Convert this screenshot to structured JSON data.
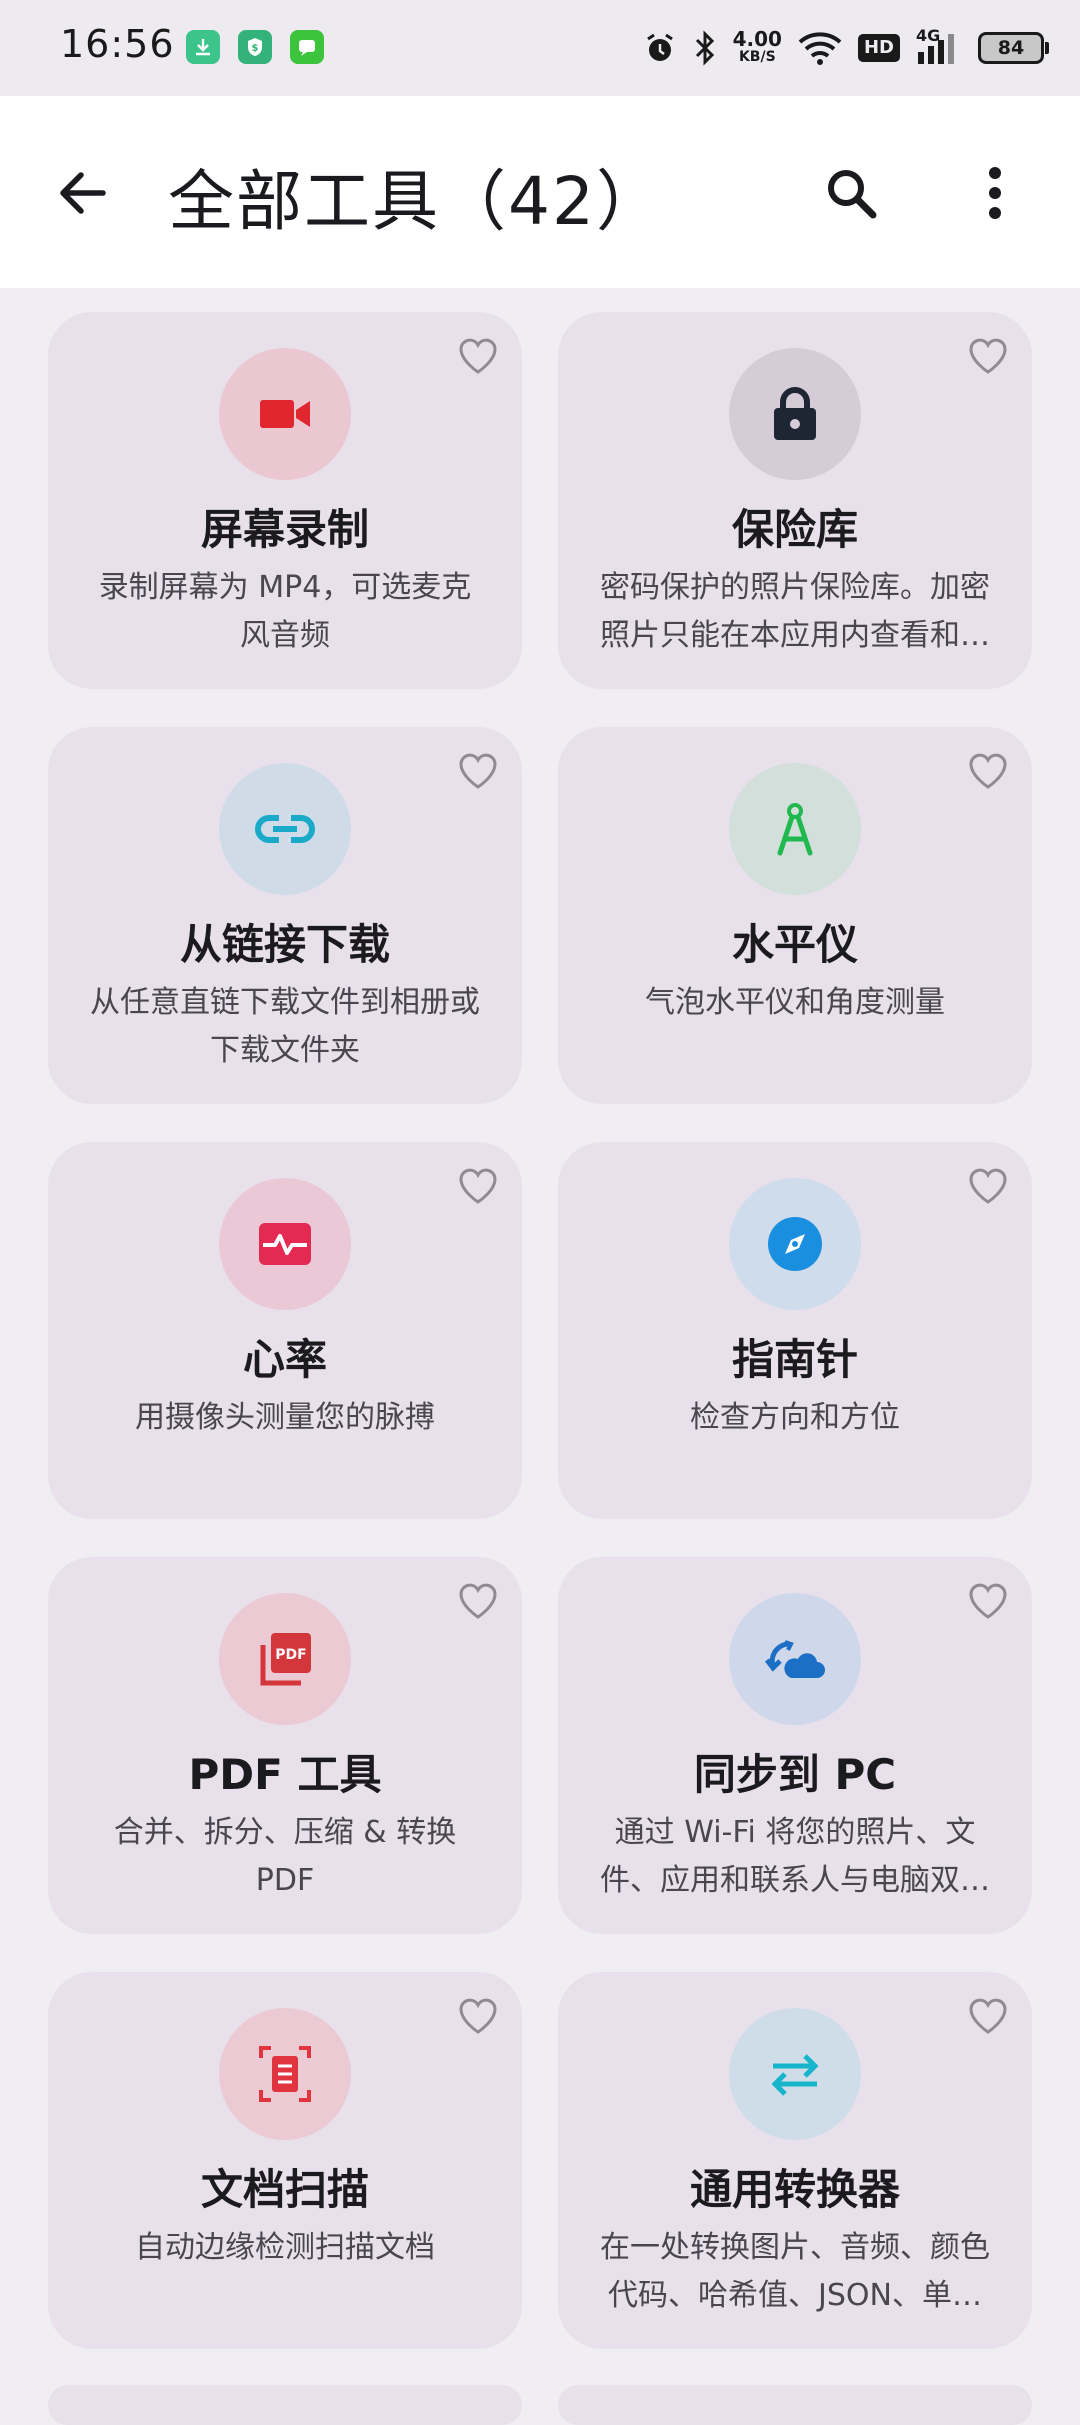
{
  "status_bar": {
    "time": "16:56",
    "net_speed_value": "4.00",
    "net_speed_unit": "KB/S",
    "hd": "HD",
    "cell": "4G",
    "battery": "84",
    "icons": [
      "download-app-icon",
      "shield-app-icon",
      "message-app-icon",
      "alarm-icon",
      "bluetooth-icon",
      "wifi-icon",
      "signal-icon",
      "battery-icon"
    ]
  },
  "app_bar": {
    "title": "全部工具（42）",
    "icons": [
      "back-arrow-icon",
      "search-icon",
      "more-vert-icon"
    ]
  },
  "tools": [
    {
      "title": "屏幕录制",
      "desc": "录制屏幕为 MP4，可选麦克风音频",
      "icon": "video-camera-icon",
      "icon_color": "#e0262e",
      "circle_color": "#ebc8d1"
    },
    {
      "title": "保险库",
      "desc": "密码保护的照片保险库。加密照片只能在本应用内查看和管理",
      "icon": "lock-icon",
      "icon_color": "#1f2633",
      "circle_color": "#d5ccd8"
    },
    {
      "title": "从链接下载",
      "desc": "从任意直链下载文件到相册或下载文件夹",
      "icon": "link-icon",
      "icon_color": "#19a9c9",
      "circle_color": "#cfdce8"
    },
    {
      "title": "水平仪",
      "desc": "气泡水平仪和角度测量",
      "icon": "compass-tool-icon",
      "icon_color": "#20b94f",
      "circle_color": "#d2dfdb"
    },
    {
      "title": "心率",
      "desc": "用摄像头测量您的脉搏",
      "icon": "heart-rate-icon",
      "icon_color": "#e42a52",
      "circle_color": "#eac8d6"
    },
    {
      "title": "指南针",
      "desc": "检查方向和方位",
      "icon": "compass-icon",
      "icon_color": "#1a8fe0",
      "circle_color": "#cfdcec"
    },
    {
      "title": "PDF 工具",
      "desc": "合并、拆分、压缩 & 转换 PDF",
      "icon": "pdf-icon",
      "icon_color": "#d3363b",
      "circle_color": "#ebcad3"
    },
    {
      "title": "同步到 PC",
      "desc": "通过 Wi-Fi 将您的照片、文件、应用和联系人与电脑双向同步",
      "icon": "sync-cloud-icon",
      "icon_color": "#1b6fc4",
      "circle_color": "#cfd8ea"
    },
    {
      "title": "文档扫描",
      "desc": "自动边缘检测扫描文档",
      "icon": "document-scan-icon",
      "icon_color": "#e0343e",
      "circle_color": "#ebcad3"
    },
    {
      "title": "通用转换器",
      "desc": "在一处转换图片、音频、颜色代码、哈希值、JSON、单位等",
      "icon": "swap-arrows-icon",
      "icon_color": "#16b5cc",
      "circle_color": "#cfdde8"
    }
  ]
}
